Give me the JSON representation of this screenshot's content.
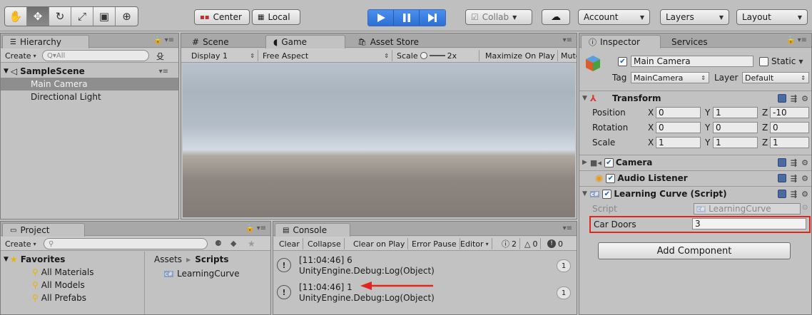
{
  "toolbar": {
    "tools": [
      {
        "icon": "hand-tool-icon",
        "glyph": "✋"
      },
      {
        "icon": "move-tool-icon",
        "glyph": "✥"
      },
      {
        "icon": "rotate-tool-icon",
        "glyph": "↻"
      },
      {
        "icon": "scale-tool-icon",
        "glyph": "⤢"
      },
      {
        "icon": "rect-tool-icon",
        "glyph": "▣"
      },
      {
        "icon": "transform-tool-icon",
        "glyph": "⊕"
      }
    ],
    "pivot_label": "Center",
    "space_label": "Local",
    "collab_label": "Collab",
    "account_label": "Account",
    "layers_label": "Layers",
    "layout_label": "Layout"
  },
  "hierarchy": {
    "tab_label": "Hierarchy",
    "create_label": "Create",
    "search_placeholder": "Q▾All",
    "scene_name": "SampleScene",
    "items": [
      "Main Camera",
      "Directional Light"
    ],
    "selected_index": 0
  },
  "center_tabs": {
    "scene_label": "Scene",
    "game_label": "Game",
    "asset_store_label": "Asset Store"
  },
  "game": {
    "display_label": "Display 1",
    "aspect_label": "Free Aspect",
    "scale_label": "Scale",
    "scale_value": "2x",
    "maximize_label": "Maximize On Play",
    "mute_label": "Mute"
  },
  "project": {
    "tab_label": "Project",
    "create_label": "Create",
    "favorites_label": "Favorites",
    "favorites": [
      "All Materials",
      "All Models",
      "All Prefabs"
    ],
    "breadcrumb_root": "Assets",
    "breadcrumb_current": "Scripts",
    "files": [
      "LearningCurve"
    ]
  },
  "console": {
    "tab_label": "Console",
    "buttons": [
      "Clear",
      "Collapse",
      "Clear on Play",
      "Error Pause",
      "Editor"
    ],
    "info_count": "2",
    "warn_count": "0",
    "error_count": "0",
    "entries": [
      {
        "line1": "[11:04:46] 6",
        "line2": "UnityEngine.Debug:Log(Object)",
        "count": "1"
      },
      {
        "line1": "[11:04:46] 1",
        "line2": "UnityEngine.Debug:Log(Object)",
        "count": "1"
      }
    ]
  },
  "inspector": {
    "tab_label": "Inspector",
    "services_label": "Services",
    "object_name": "Main Camera",
    "static_label": "Static",
    "tag_label": "Tag",
    "tag_value": "MainCamera",
    "layer_label": "Layer",
    "layer_value": "Default",
    "transform_label": "Transform",
    "position_label": "Position",
    "rotation_label": "Rotation",
    "scale_label": "Scale",
    "position": {
      "x": "0",
      "y": "1",
      "z": "-10"
    },
    "rotation": {
      "x": "0",
      "y": "0",
      "z": "0"
    },
    "scale": {
      "x": "1",
      "y": "1",
      "z": "1"
    },
    "axis_x": "X",
    "axis_y": "Y",
    "axis_z": "Z",
    "camera_label": "Camera",
    "audio_listener_label": "Audio Listener",
    "script_component_label": "Learning Curve (Script)",
    "script_field_label": "Script",
    "script_field_value": "LearningCurve",
    "car_doors_label": "Car Doors",
    "car_doors_value": "3",
    "add_component_label": "Add Component"
  },
  "colors": {
    "play_blue": "#2e6fd4",
    "highlight_red": "#e0261f",
    "selection_gray": "#8e8e8e"
  }
}
